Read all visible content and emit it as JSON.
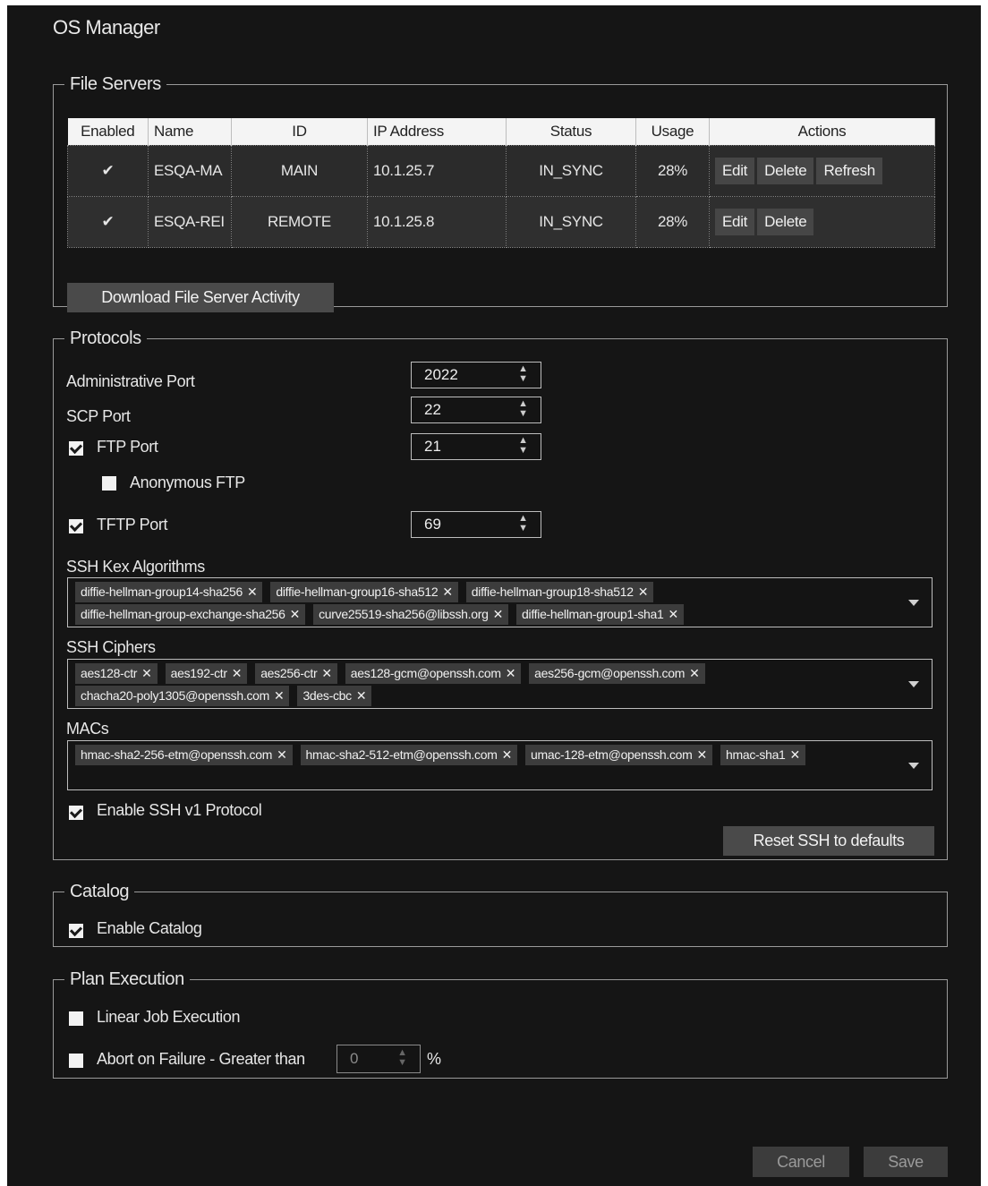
{
  "title": "OS Manager",
  "file_servers": {
    "legend": "File Servers",
    "columns": [
      "Enabled",
      "Name",
      "ID",
      "IP Address",
      "Status",
      "Usage",
      "Actions"
    ],
    "rows": [
      {
        "enabled": "✔",
        "name": "ESQA-MA",
        "id": "MAIN",
        "ip": "10.1.25.7",
        "status": "IN_SYNC",
        "usage": "28%",
        "edit": "Edit",
        "delete": "Delete",
        "refresh": "Refresh"
      },
      {
        "enabled": "✔",
        "name": "ESQA-REI",
        "id": "REMOTE",
        "ip": "10.1.25.8",
        "status": "IN_SYNC",
        "usage": "28%",
        "edit": "Edit",
        "delete": "Delete"
      }
    ],
    "download_label": "Download File Server Activity"
  },
  "protocols": {
    "legend": "Protocols",
    "admin_port_label": "Administrative Port",
    "admin_port": "2022",
    "scp_port_label": "SCP Port",
    "scp_port": "22",
    "ftp_port_label": "FTP Port",
    "ftp_port": "21",
    "ftp_enabled": true,
    "anon_ftp_label": "Anonymous FTP",
    "anon_ftp": false,
    "tftp_port_label": "TFTP Port",
    "tftp_port": "69",
    "tftp_enabled": true,
    "kex_label": "SSH Kex Algorithms",
    "kex": [
      "diffie-hellman-group14-sha256",
      "diffie-hellman-group16-sha512",
      "diffie-hellman-group18-sha512",
      "diffie-hellman-group-exchange-sha256",
      "curve25519-sha256@libssh.org",
      "diffie-hellman-group1-sha1"
    ],
    "ciphers_label": "SSH Ciphers",
    "ciphers": [
      "aes128-ctr",
      "aes192-ctr",
      "aes256-ctr",
      "aes128-gcm@openssh.com",
      "aes256-gcm@openssh.com",
      "chacha20-poly1305@openssh.com",
      "3des-cbc"
    ],
    "macs_label": "MACs",
    "macs": [
      "hmac-sha2-256-etm@openssh.com",
      "hmac-sha2-512-etm@openssh.com",
      "umac-128-etm@openssh.com",
      "hmac-sha1"
    ],
    "ssh_v1_label": "Enable SSH v1 Protocol",
    "ssh_v1": true,
    "reset_label": "Reset SSH to defaults"
  },
  "catalog": {
    "legend": "Catalog",
    "enable_label": "Enable Catalog",
    "enabled": true
  },
  "plan_execution": {
    "legend": "Plan Execution",
    "linear_label": "Linear Job Execution",
    "linear": false,
    "abort_label": "Abort on Failure - Greater than",
    "abort": false,
    "abort_value": "0",
    "abort_unit": "%"
  },
  "footer": {
    "cancel": "Cancel",
    "save": "Save"
  }
}
